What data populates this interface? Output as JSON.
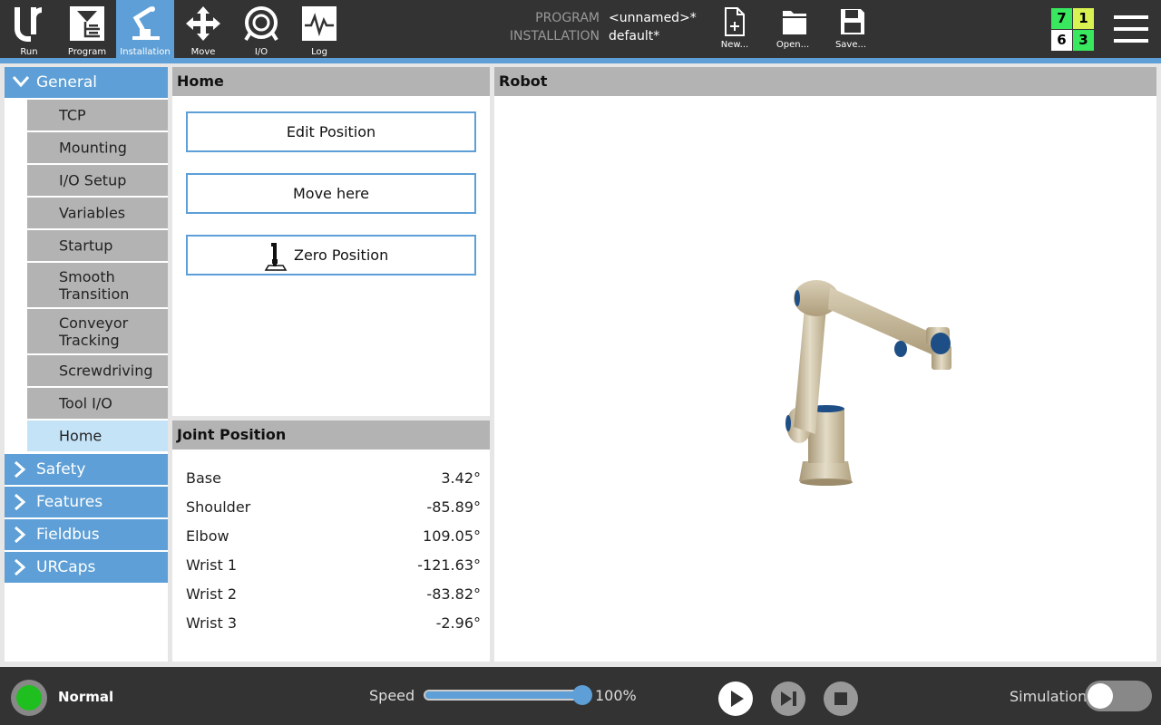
{
  "topbar": {
    "tabs": [
      {
        "label": "Run",
        "icon": "ur-logo-icon"
      },
      {
        "label": "Program",
        "icon": "program-icon"
      },
      {
        "label": "Installation",
        "icon": "installation-icon"
      },
      {
        "label": "Move",
        "icon": "move-icon"
      },
      {
        "label": "I/O",
        "icon": "io-icon"
      },
      {
        "label": "Log",
        "icon": "log-icon"
      }
    ],
    "program_label": "PROGRAM",
    "program_value": "<unnamed>*",
    "installation_label": "INSTALLATION",
    "installation_value": "default*",
    "file_buttons": [
      {
        "label": "New...",
        "icon": "new-file-icon"
      },
      {
        "label": "Open...",
        "icon": "open-folder-icon"
      },
      {
        "label": "Save...",
        "icon": "save-icon"
      }
    ],
    "counters": [
      "7",
      "1",
      "6",
      "3"
    ],
    "counter_colors": [
      "#39e85f",
      "#d8f251",
      "#ffffff",
      "#39e85f"
    ],
    "menu_icon": "hamburger-menu-icon"
  },
  "sidebar": {
    "general": "General",
    "items": [
      {
        "label": "TCP"
      },
      {
        "label": "Mounting"
      },
      {
        "label": "I/O Setup"
      },
      {
        "label": "Variables"
      },
      {
        "label": "Startup"
      },
      {
        "label": "Smooth Transition"
      },
      {
        "label": "Conveyor Tracking"
      },
      {
        "label": "Screwdriving"
      },
      {
        "label": "Tool I/O"
      },
      {
        "label": "Home"
      }
    ],
    "sections": [
      "Safety",
      "Features",
      "Fieldbus",
      "URCaps"
    ]
  },
  "home_panel": {
    "title": "Home",
    "edit_position": "Edit Position",
    "move_here": "Move here",
    "zero_position": "Zero Position"
  },
  "joint_panel": {
    "title": "Joint Position",
    "joints": [
      {
        "name": "Base",
        "value": "3.42°"
      },
      {
        "name": "Shoulder",
        "value": "-85.89°"
      },
      {
        "name": "Elbow",
        "value": "109.05°"
      },
      {
        "name": "Wrist 1",
        "value": "-121.63°"
      },
      {
        "name": "Wrist 2",
        "value": "-83.82°"
      },
      {
        "name": "Wrist 3",
        "value": "-2.96°"
      }
    ]
  },
  "robot_panel": {
    "title": "Robot"
  },
  "bottombar": {
    "status": "Normal",
    "status_color": "#1fbf1f",
    "speed_label": "Speed",
    "speed_value": "100%",
    "speed_fraction": 1.0,
    "simulation_label": "Simulation"
  }
}
